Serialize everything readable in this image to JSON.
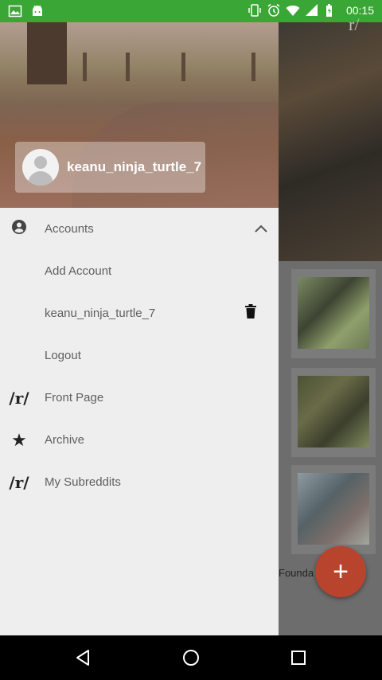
{
  "status_bar": {
    "time": "00:15",
    "left_icons": [
      "image-icon",
      "android-icon"
    ],
    "right_icons": [
      "vibrate-icon",
      "alarm-icon",
      "wifi-icon",
      "signal-icon",
      "battery-icon"
    ]
  },
  "background": {
    "header_title": "r/",
    "footer_text": "Founda",
    "fab_label": "+"
  },
  "drawer": {
    "username": "keanu_ninja_turtle_7",
    "items": [
      {
        "label": "Accounts",
        "icon": "account-circle-icon"
      },
      {
        "label": "Add Account"
      },
      {
        "label": "keanu_ninja_turtle_7",
        "trailing_icon": "trash-icon"
      },
      {
        "label": "Logout"
      },
      {
        "label": "Front Page",
        "icon_text": "/r/"
      },
      {
        "label": "Archive",
        "icon": "star-icon"
      },
      {
        "label": "My Subreddits",
        "icon_text": "/r/"
      }
    ]
  },
  "nav_bar": {
    "buttons": [
      "back-icon",
      "home-icon",
      "recents-icon"
    ]
  },
  "colors": {
    "status_bar": "#3aa636",
    "fab": "#b8442e",
    "drawer_bg": "#eeeeee"
  }
}
